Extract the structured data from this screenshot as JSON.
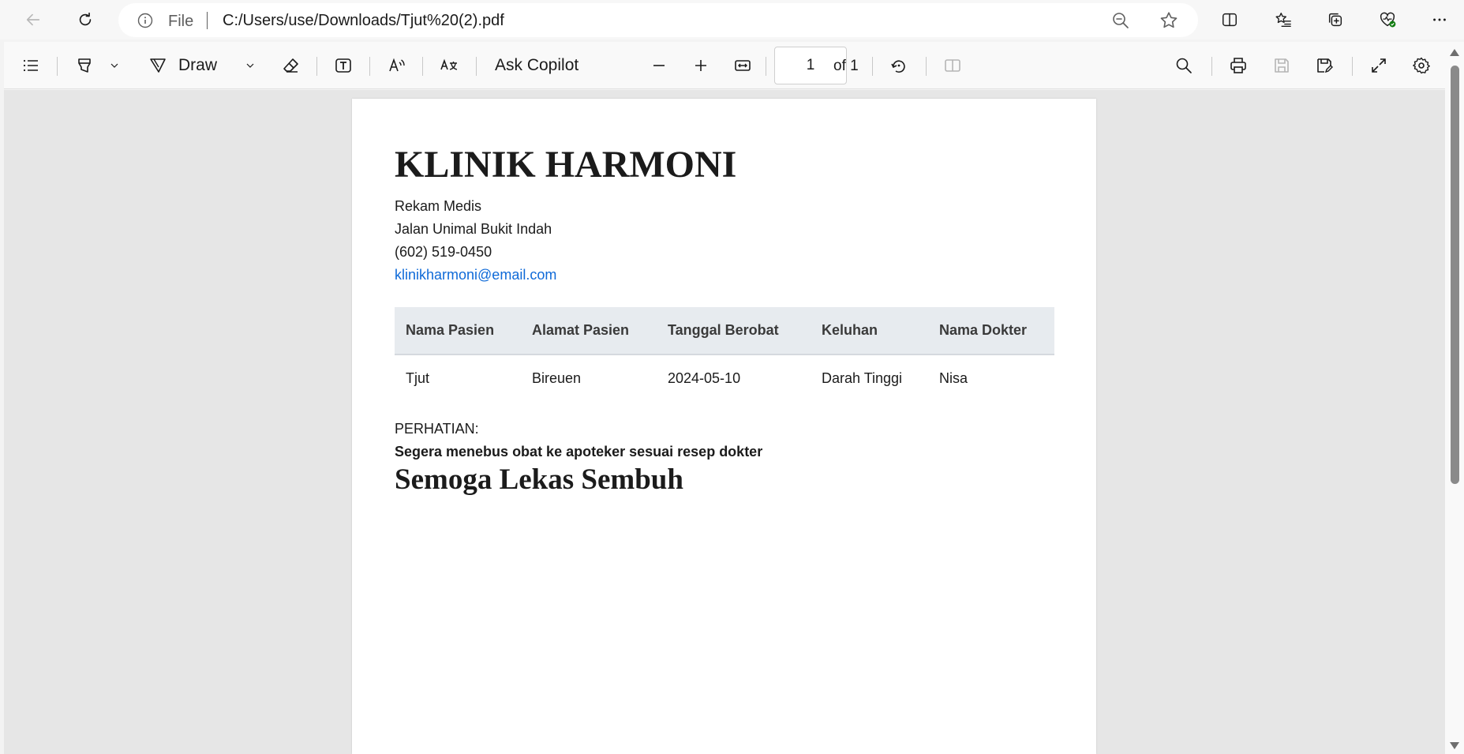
{
  "browser": {
    "address": {
      "scheme_label": "File",
      "url": "C:/Users/use/Downloads/Tjut%20(2).pdf"
    },
    "icons": {
      "back": "back-arrow-icon",
      "refresh": "refresh-icon",
      "info": "info-icon",
      "zoom": "zoom-out-icon",
      "favorite": "star-icon",
      "split": "split-screen-icon",
      "favorites": "favorites-icon",
      "collections": "collections-icon",
      "health": "browser-essentials-icon",
      "more": "more-icon"
    }
  },
  "pdf_toolbar": {
    "draw_label": "Draw",
    "ask_copilot_label": "Ask Copilot",
    "current_page": "1",
    "page_total_label": "of 1"
  },
  "document": {
    "title": "KLINIK HARMONI",
    "subtitle": "Rekam Medis",
    "address": "Jalan Unimal Bukit Indah",
    "phone": "(602) 519-0450",
    "email": "klinikharmoni@email.com",
    "table": {
      "headers": [
        "Nama Pasien",
        "Alamat Pasien",
        "Tanggal Berobat",
        "Keluhan",
        "Nama Dokter"
      ],
      "rows": [
        [
          "Tjut",
          "Bireuen",
          "2024-05-10",
          "Darah Tinggi",
          "Nisa"
        ]
      ]
    },
    "notice_label": "PERHATIAN:",
    "notice_text": "Segera menebus obat ke apoteker sesuai resep dokter",
    "closing": "Semoga Lekas Sembuh"
  },
  "colors": {
    "link": "#0f6ad8",
    "table_header_bg": "#e7ebef",
    "viewer_bg": "#e6e6e6"
  }
}
